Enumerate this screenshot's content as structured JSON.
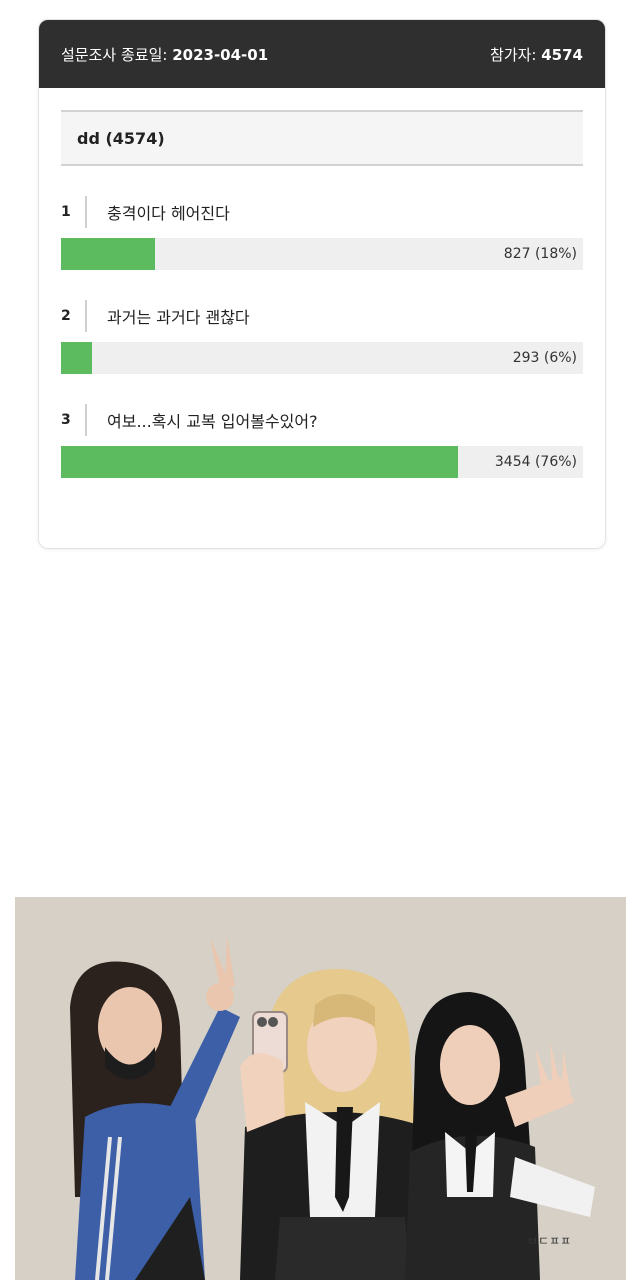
{
  "poll": {
    "header": {
      "end_label": "설문조사 종료일: ",
      "end_date": "2023-04-01",
      "participants_label": "참가자: ",
      "participants_count": "4574"
    },
    "question": "dd (4574)",
    "options": [
      {
        "number": "1",
        "label": "충격이다 헤어진다",
        "result_text": "827 (18%)",
        "votes": 827,
        "percent": 18
      },
      {
        "number": "2",
        "label": "과거는 과거다 괜찮다",
        "result_text": "293 (6%)",
        "votes": 293,
        "percent": 6
      },
      {
        "number": "3",
        "label": "여보...혹시 교복 입어볼수있어?",
        "result_text": "3454 (76%)",
        "votes": 3454,
        "percent": 76
      }
    ],
    "bar_color": "#5cbb5f"
  },
  "illustration": {
    "signature": "ㅂㄷㅍㅍ",
    "background_color": "#d6d0c6"
  }
}
